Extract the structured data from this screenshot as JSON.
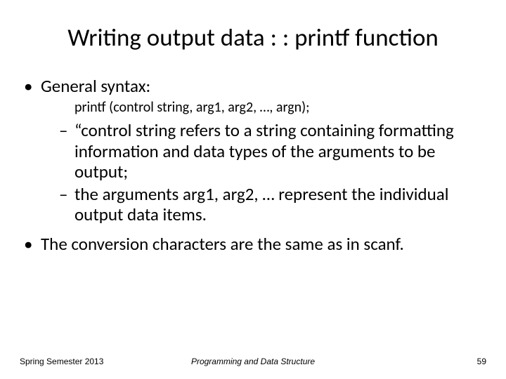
{
  "title": "Writing output data : : printf function",
  "bullets": {
    "generalSyntax": "General syntax:",
    "codeLine": "printf (control string, arg1, arg2, …, argn);",
    "sub1": "“control string refers to a string containing formatting information and data types of the arguments to be output;",
    "sub2": "the arguments arg1, arg2, … represent the individual output data items.",
    "b2": "The conversion characters are the same as in scanf."
  },
  "footer": {
    "left": "Spring Semester 2013",
    "center": "Programming and Data Structure",
    "right": "59"
  }
}
